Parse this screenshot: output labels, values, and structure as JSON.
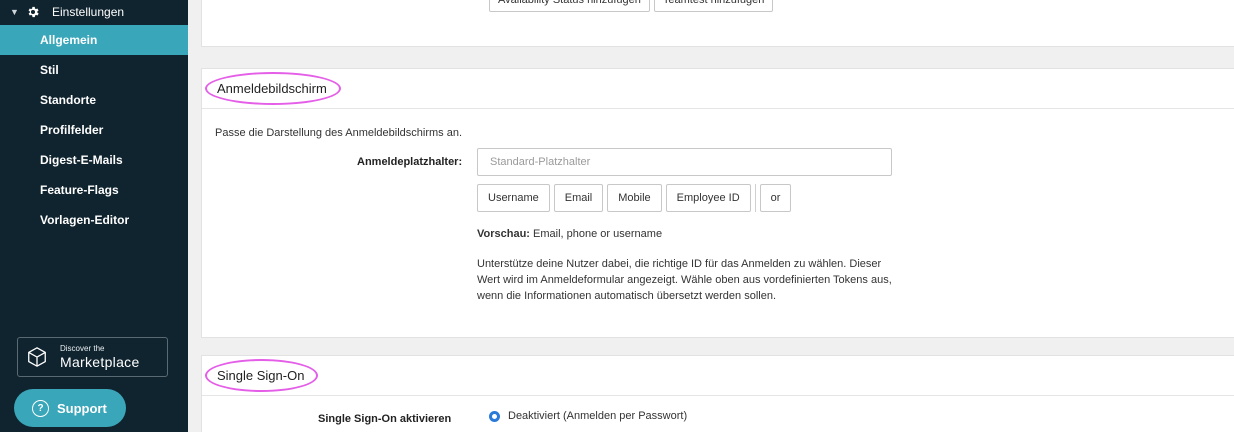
{
  "sidebar": {
    "parent_label": "Einstellungen",
    "items": [
      {
        "label": "Allgemein",
        "active": true
      },
      {
        "label": "Stil",
        "active": false
      },
      {
        "label": "Standorte",
        "active": false
      },
      {
        "label": "Profilfelder",
        "active": false
      },
      {
        "label": "Digest-E-Mails",
        "active": false
      },
      {
        "label": "Feature-Flags",
        "active": false
      },
      {
        "label": "Vorlagen-Editor",
        "active": false
      }
    ],
    "marketplace": {
      "small": "Discover the",
      "big": "Marketplace"
    },
    "support": {
      "label": "Support",
      "icon": "?"
    }
  },
  "top_panel": {
    "buttons": [
      "Availability Status hinzufügen",
      "Teamtest hinzufügen"
    ]
  },
  "anmelde": {
    "title": "Anmeldebildschirm",
    "description": "Passe die Darstellung des Anmeldebildschirms an.",
    "field_label": "Anmeldeplatzhalter:",
    "placeholder": "Standard-Platzhalter",
    "tokens": [
      "Username",
      "Email",
      "Mobile",
      "Employee ID"
    ],
    "token_extra": "or",
    "preview_label": "Vorschau:",
    "preview_value": "Email, phone or username",
    "help": "Unterstütze deine Nutzer dabei, die richtige ID für das Anmelden zu wählen. Dieser Wert wird im Anmeldeformular angezeigt. Wähle oben aus vordefinierten Tokens aus, wenn die Informationen automatisch übersetzt werden sollen."
  },
  "sso": {
    "title": "Single Sign-On",
    "label": "Single Sign-On aktivieren",
    "option": "Deaktiviert (Anmelden per Passwort)"
  },
  "colors": {
    "sidebar_bg": "#10242f",
    "accent": "#3aa6b9",
    "annotation": "#e45ee8",
    "radio": "#2a7ad9"
  }
}
